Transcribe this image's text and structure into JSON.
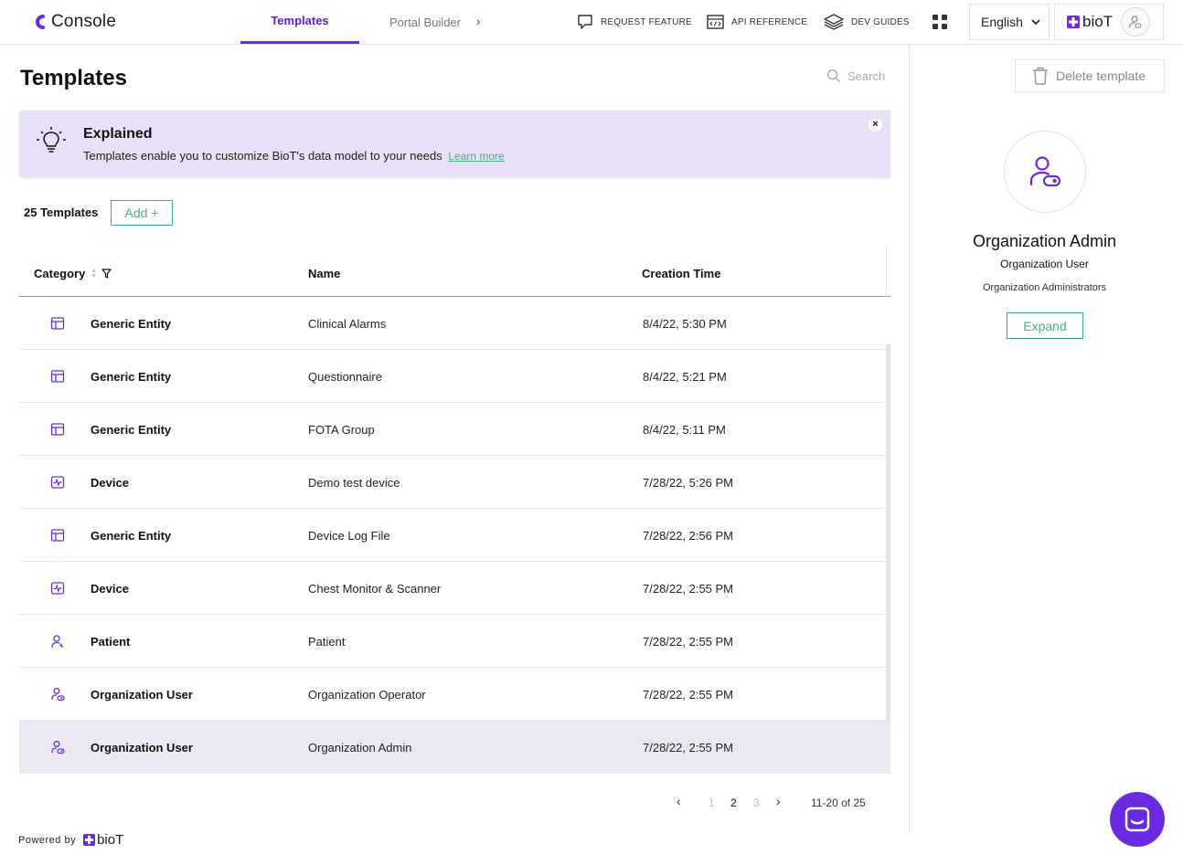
{
  "header": {
    "app_name": "Console",
    "tabs": [
      {
        "label": "Templates",
        "active": true
      },
      {
        "label": "Portal Builder",
        "active": false
      }
    ],
    "links": [
      {
        "label": "REQUEST FEATURE",
        "icon": "chat-bubble-icon"
      },
      {
        "label": "API REFERENCE",
        "icon": "code-window-icon"
      },
      {
        "label": "DEV GUIDES",
        "icon": "layers-icon"
      }
    ],
    "language": "English",
    "brand": "bioT"
  },
  "main": {
    "title": "Templates",
    "search_placeholder": "Search",
    "banner": {
      "title": "Explained",
      "text": "Templates enable you to customize BioT's data model to your needs",
      "link": "Learn more",
      "close": "×"
    },
    "count_label": "25 Templates",
    "add_label": "Add +",
    "table": {
      "columns": [
        "Category",
        "Name",
        "Creation Time"
      ],
      "rows": [
        {
          "icon": "entity",
          "category": "Generic Entity",
          "name": "Clinical Alarms",
          "time": "8/4/22, 5:30 PM"
        },
        {
          "icon": "entity",
          "category": "Generic Entity",
          "name": "Questionnaire",
          "time": "8/4/22, 5:21 PM"
        },
        {
          "icon": "entity",
          "category": "Generic Entity",
          "name": "FOTA Group",
          "time": "8/4/22, 5:11 PM"
        },
        {
          "icon": "device",
          "category": "Device",
          "name": "Demo test device",
          "time": "7/28/22, 5:26 PM"
        },
        {
          "icon": "entity",
          "category": "Generic Entity",
          "name": "Device Log File",
          "time": "7/28/22, 2:56 PM"
        },
        {
          "icon": "device",
          "category": "Device",
          "name": "Chest Monitor & Scanner",
          "time": "7/28/22, 2:55 PM"
        },
        {
          "icon": "patient",
          "category": "Patient",
          "name": "Patient",
          "time": "7/28/22, 2:55 PM"
        },
        {
          "icon": "org-user",
          "category": "Organization User",
          "name": "Organization Operator",
          "time": "7/28/22, 2:55 PM"
        },
        {
          "icon": "org-user",
          "category": "Organization User",
          "name": "Organization Admin",
          "time": "7/28/22, 2:55 PM",
          "selected": true
        }
      ]
    },
    "pagination": {
      "prev": "‹",
      "pages": [
        "1",
        "2",
        "3"
      ],
      "current": "2",
      "next": "›",
      "range": "11-20 of 25"
    },
    "powered_by": "Powered by",
    "powered_brand": "bioT"
  },
  "detail": {
    "delete_label": "Delete template",
    "title": "Organization Admin",
    "subtitle": "Organization User",
    "description": "Organization Administrators",
    "expand_label": "Expand"
  },
  "colors": {
    "accent": "#6a2ae0",
    "green": "#3fb27f",
    "banner_bg": "#e9e0f7",
    "selected_row": "#ece8f3"
  }
}
